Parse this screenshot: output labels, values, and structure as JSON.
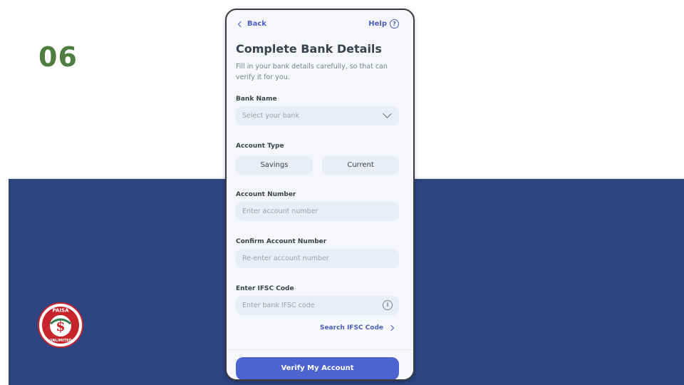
{
  "slide": {
    "number": "06"
  },
  "logo": {
    "top_text": "PAISA",
    "bottom_text": "UNLIMITED",
    "symbol": "$",
    "color": "#c7242b"
  },
  "colors": {
    "band": "#2e4480",
    "accent": "#4a5fc1",
    "primary_button": "#4d63cf",
    "slide_number": "#4f7e41"
  },
  "nav": {
    "back_label": "Back",
    "help_label": "Help",
    "help_symbol": "?"
  },
  "form": {
    "title": "Complete Bank Details",
    "subtitle": "Fill in your bank details carefully, so that can verify it for you.",
    "bank_name": {
      "label": "Bank Name",
      "placeholder": "Select your bank"
    },
    "account_type": {
      "label": "Account Type",
      "options": [
        "Savings",
        "Current"
      ]
    },
    "account_number": {
      "label": "Account Number",
      "placeholder": "Enter account number"
    },
    "confirm_account": {
      "label": "Confirm Account Number",
      "placeholder": "Re-enter account number"
    },
    "ifsc": {
      "label": "Enter IFSC Code",
      "placeholder": "Enter bank IFSC code",
      "info_symbol": "i"
    },
    "search_ifsc_label": "Search IFSC Code",
    "submit_label": "Verify My Account"
  },
  "icons": [
    "chevron-left-icon",
    "help-icon",
    "chevron-down-icon",
    "info-icon",
    "chevron-right-icon",
    "paisa-logo"
  ]
}
